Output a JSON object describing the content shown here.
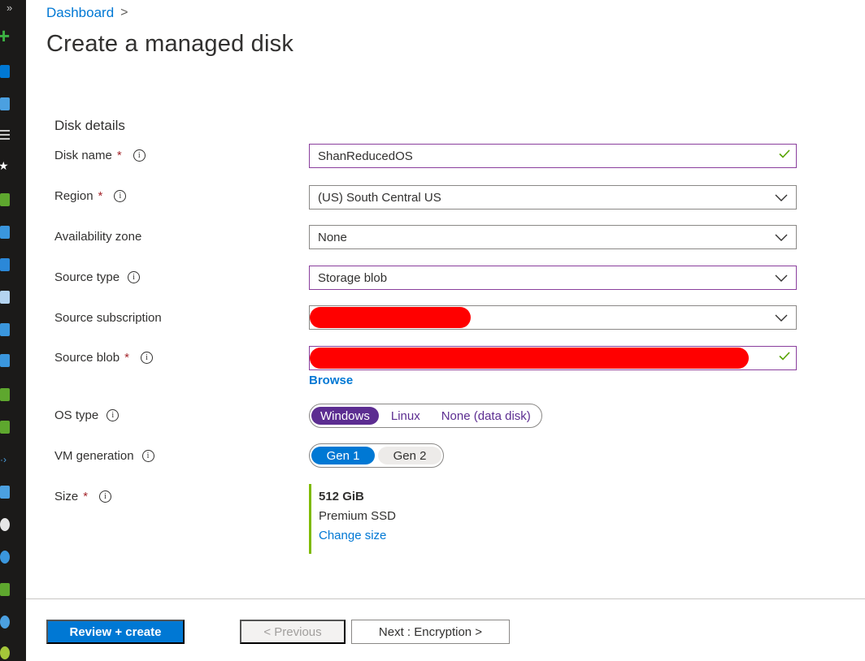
{
  "app": {
    "accent": "#0078d4",
    "os_accent": "#5c2d91"
  },
  "breadcrumb": {
    "items": [
      "Dashboard"
    ],
    "separator": ">"
  },
  "page": {
    "title": "Create a managed disk"
  },
  "section": {
    "heading": "Disk details"
  },
  "fields": {
    "disk_name": {
      "label": "Disk name",
      "required": "*",
      "value": "ShanReducedOS",
      "valid": true
    },
    "region": {
      "label": "Region",
      "required": "*",
      "value": "(US) South Central US"
    },
    "availability_zone": {
      "label": "Availability zone",
      "value": "None"
    },
    "source_type": {
      "label": "Source type",
      "value": "Storage blob"
    },
    "source_subscription": {
      "label": "Source subscription",
      "value_redacted": true
    },
    "source_blob": {
      "label": "Source blob",
      "required": "*",
      "value_redacted": true,
      "valid": true,
      "browse_label": "Browse"
    },
    "os_type": {
      "label": "OS type",
      "options": [
        "Windows",
        "Linux",
        "None (data disk)"
      ],
      "selected": "Windows"
    },
    "vm_generation": {
      "label": "VM generation",
      "options": [
        "Gen 1",
        "Gen 2"
      ],
      "selected": "Gen 1"
    },
    "size": {
      "label": "Size",
      "required": "*",
      "value": "512 GiB",
      "tier": "Premium SSD",
      "change_label": "Change size"
    }
  },
  "icons": {
    "info": "info-circle-icon",
    "check": "checkmark-icon",
    "dropdown": "chevron-down-icon"
  },
  "footer": {
    "review_create": "Review + create",
    "previous": "< Previous",
    "next": "Next : Encryption >"
  },
  "sidebar": {
    "expand_glyph": "»"
  }
}
